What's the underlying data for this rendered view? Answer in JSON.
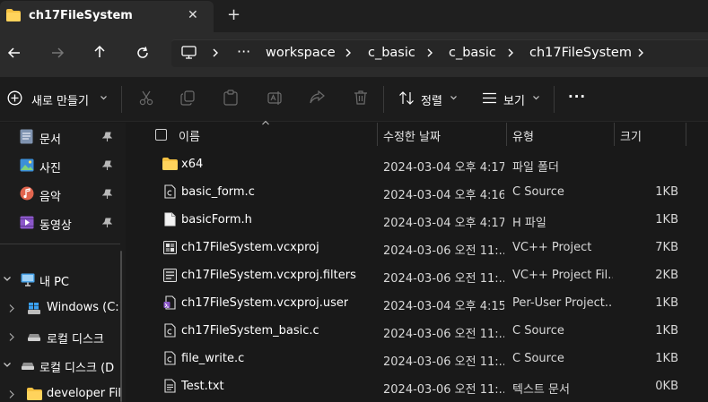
{
  "window": {
    "tab_title": "ch17FileSystem",
    "close_glyph": "✕",
    "new_tab_glyph": "+"
  },
  "breadcrumb": {
    "overflow": "···",
    "items": [
      "workspace",
      "c_basic",
      "c_basic",
      "ch17FileSystem"
    ]
  },
  "toolbar": {
    "new_label": "새로 만들기",
    "sort_label": "정렬",
    "view_label": "보기",
    "more_glyph": "···"
  },
  "sidebar": {
    "quick_access": [
      {
        "label": "문서",
        "icon": "documents-icon"
      },
      {
        "label": "사진",
        "icon": "pictures-icon"
      },
      {
        "label": "음악",
        "icon": "music-icon"
      },
      {
        "label": "동영상",
        "icon": "videos-icon"
      }
    ],
    "this_pc": "내 PC",
    "drives": [
      "Windows (C:)",
      "로컬 디스크",
      "로컬 디스크 (D",
      "developer Fil"
    ]
  },
  "columns": {
    "name": "이름",
    "date": "수정한 날짜",
    "type": "유형",
    "size": "크기"
  },
  "files": [
    {
      "name": "x64",
      "date": "2024-03-04 오후 4:17",
      "type": "파일 폴더",
      "size": "",
      "icon": "folder-icon"
    },
    {
      "name": "basic_form.c",
      "date": "2024-03-04 오후 4:16",
      "type": "C Source",
      "size": "1KB",
      "icon": "c-source-icon"
    },
    {
      "name": "basicForm.h",
      "date": "2024-03-04 오후 4:17",
      "type": "H 파일",
      "size": "1KB",
      "icon": "header-file-icon"
    },
    {
      "name": "ch17FileSystem.vcxproj",
      "date": "2024-03-06 오전 11:...",
      "type": "VC++ Project",
      "size": "7KB",
      "icon": "vcxproj-icon"
    },
    {
      "name": "ch17FileSystem.vcxproj.filters",
      "date": "2024-03-06 오전 11:...",
      "type": "VC++ Project Fil...",
      "size": "2KB",
      "icon": "filters-file-icon"
    },
    {
      "name": "ch17FileSystem.vcxproj.user",
      "date": "2024-03-04 오후 4:15",
      "type": "Per-User Project...",
      "size": "1KB",
      "icon": "user-file-icon"
    },
    {
      "name": "ch17FileSystem_basic.c",
      "date": "2024-03-06 오전 11:...",
      "type": "C Source",
      "size": "1KB",
      "icon": "c-source-icon"
    },
    {
      "name": "file_write.c",
      "date": "2024-03-06 오전 11:...",
      "type": "C Source",
      "size": "1KB",
      "icon": "c-source-icon"
    },
    {
      "name": "Test.txt",
      "date": "2024-03-06 오전 11:...",
      "type": "텍스트 문서",
      "size": "0KB",
      "icon": "text-file-icon"
    }
  ]
}
